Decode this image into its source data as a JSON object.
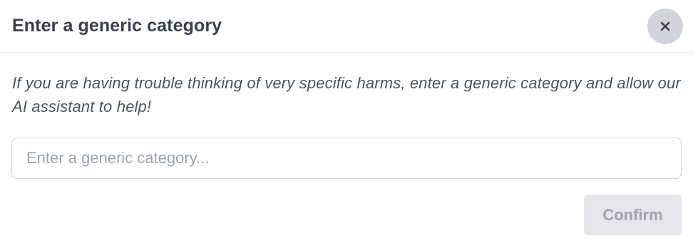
{
  "modal": {
    "title": "Enter a generic category",
    "close_icon": "close-icon",
    "description": "If you are having trouble thinking of very specific harms, enter a generic category and allow our AI assistant to help!",
    "input": {
      "value": "",
      "placeholder": "Enter a generic category..."
    },
    "confirm_label": "Confirm",
    "confirm_disabled": true
  },
  "colors": {
    "title": "#374151",
    "close_button_bg": "#d1d5db",
    "description": "#4b5563",
    "placeholder": "#9ca3af",
    "confirm_bg": "#e5e7eb",
    "confirm_text": "#9ca3af"
  }
}
